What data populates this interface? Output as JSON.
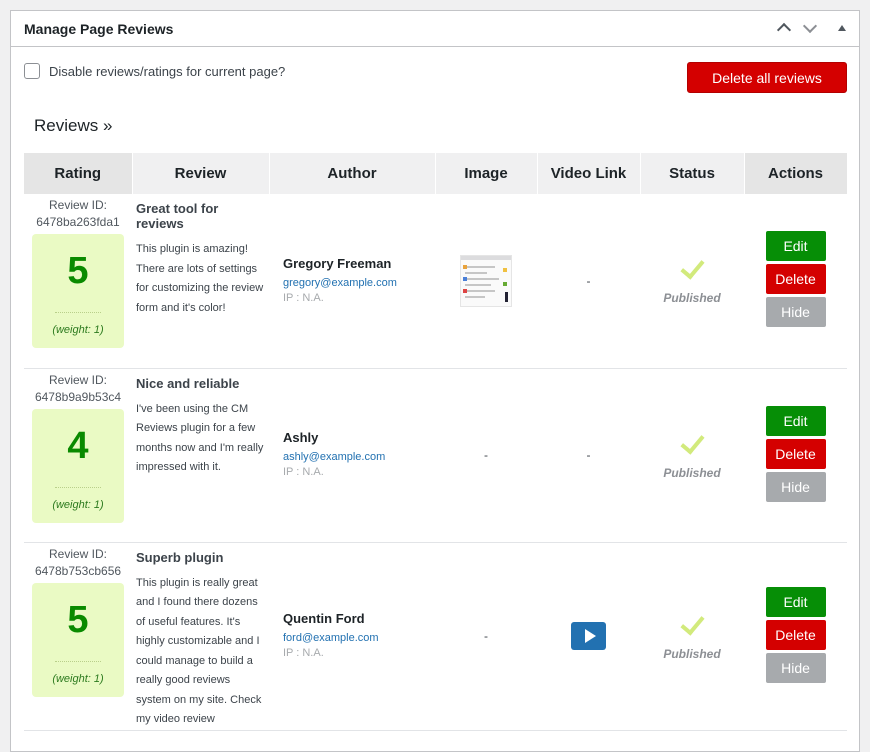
{
  "panel": {
    "title": "Manage Page Reviews",
    "controls": [
      "chevron-up-icon",
      "chevron-down-icon",
      "triangle-up-icon"
    ]
  },
  "disable": {
    "label": "Disable reviews/ratings for current page?",
    "checked": false
  },
  "delete_all_label": "Delete all reviews",
  "reviews_heading": "Reviews »",
  "columns": [
    "Rating",
    "Review",
    "Author",
    "Image",
    "Video Link",
    "Status",
    "Actions"
  ],
  "rows": [
    {
      "id_label": "Review ID:",
      "id": "6478ba263fda1",
      "rating": "5",
      "weight": "(weight: 1)",
      "title": "Great tool for reviews",
      "text": "This plugin is amazing! There are lots of settings for customizing the review form and it's color!",
      "author": "Gregory Freeman",
      "email": "gregory@example.com",
      "ip": "IP : N.A.",
      "image": "thumbnail",
      "video": "-",
      "status": "Published",
      "edit": "Edit",
      "delete": "Delete",
      "hide": "Hide"
    },
    {
      "id_label": "Review ID:",
      "id": "6478b9a9b53c4",
      "rating": "4",
      "weight": "(weight: 1)",
      "title": "Nice and reliable",
      "text": "I've been using the CM Reviews plugin for a few months now and I'm really impressed with it.",
      "author": "Ashly",
      "email": "ashly@example.com",
      "ip": "IP : N.A.",
      "image": "-",
      "video": "-",
      "status": "Published",
      "edit": "Edit",
      "delete": "Delete",
      "hide": "Hide"
    },
    {
      "id_label": "Review ID:",
      "id": "6478b753cb656",
      "rating": "5",
      "weight": "(weight: 1)",
      "title": "Superb plugin",
      "text": "This plugin is really great and I found there dozens of useful features. It's highly customizable and I could manage to build a really good reviews system on my site. Check my video review",
      "author": "Quentin Ford",
      "email": "ford@example.com",
      "ip": "IP : N.A.",
      "image": "-",
      "video": "play-icon",
      "status": "Published",
      "edit": "Edit",
      "delete": "Delete",
      "hide": "Hide"
    }
  ],
  "colors": {
    "edit": "#068e06",
    "delete": "#d40000",
    "hide": "#a7aaad",
    "rating_bg": "#eafac4",
    "rating_num": "#0a8a00",
    "check": "#d2ea7c",
    "play": "#2271b1"
  }
}
